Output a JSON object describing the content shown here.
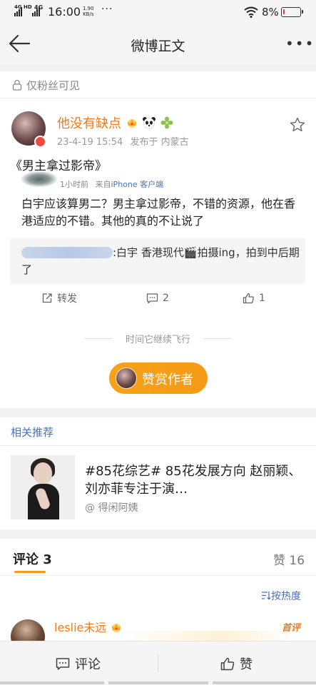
{
  "status_bar": {
    "net1": "4G HD",
    "net2": "4G",
    "time": "16:00",
    "speed": "1.90",
    "speed_unit": "KB/s",
    "more": "···",
    "battery_pct": "8%",
    "battery_level": 0.08,
    "battery_color": "#e53935"
  },
  "nav": {
    "title": "微博正文",
    "more": "•••"
  },
  "visibility": {
    "label": "仅粉丝可见"
  },
  "post": {
    "username": "他没有缺点",
    "timestamp": "23-4-19 15:54",
    "location": "发布于 内蒙古",
    "title": "《男主拿过影帝》",
    "sub_time": "1小时前",
    "sub_source_prefix": "来自",
    "sub_source": "iPhone 客户端",
    "body": "白宇应该算男二？男主拿过影帝，不错的资源，他在香港适应的不错。其他的真的不让说了",
    "quote_text": ":白宇 香港现代🎬拍摄ing，拍到中后期了",
    "reposts_label": "转发",
    "comments_count": "2",
    "likes_count": "1"
  },
  "divider": {
    "text": "时间它继续飞行"
  },
  "reward": {
    "label": "赞赏作者"
  },
  "related": {
    "header": "相关推荐",
    "title": "#85花综艺# 85花发展方向 赵丽颖、刘亦菲专注于演…",
    "source": "@ 得闲阿姨"
  },
  "comments": {
    "tab_label": "评论 3",
    "likes_label": "赞 16",
    "sort_label": "按热度",
    "first_comment": {
      "username": "leslie未远",
      "badge": "首评"
    }
  },
  "bottom_bar": {
    "comment_label": "评论",
    "like_label": "赞"
  },
  "colors": {
    "accent_orange": "#f27a17",
    "link_blue": "#4a72b0",
    "reward_orange": "#f7a21a"
  }
}
